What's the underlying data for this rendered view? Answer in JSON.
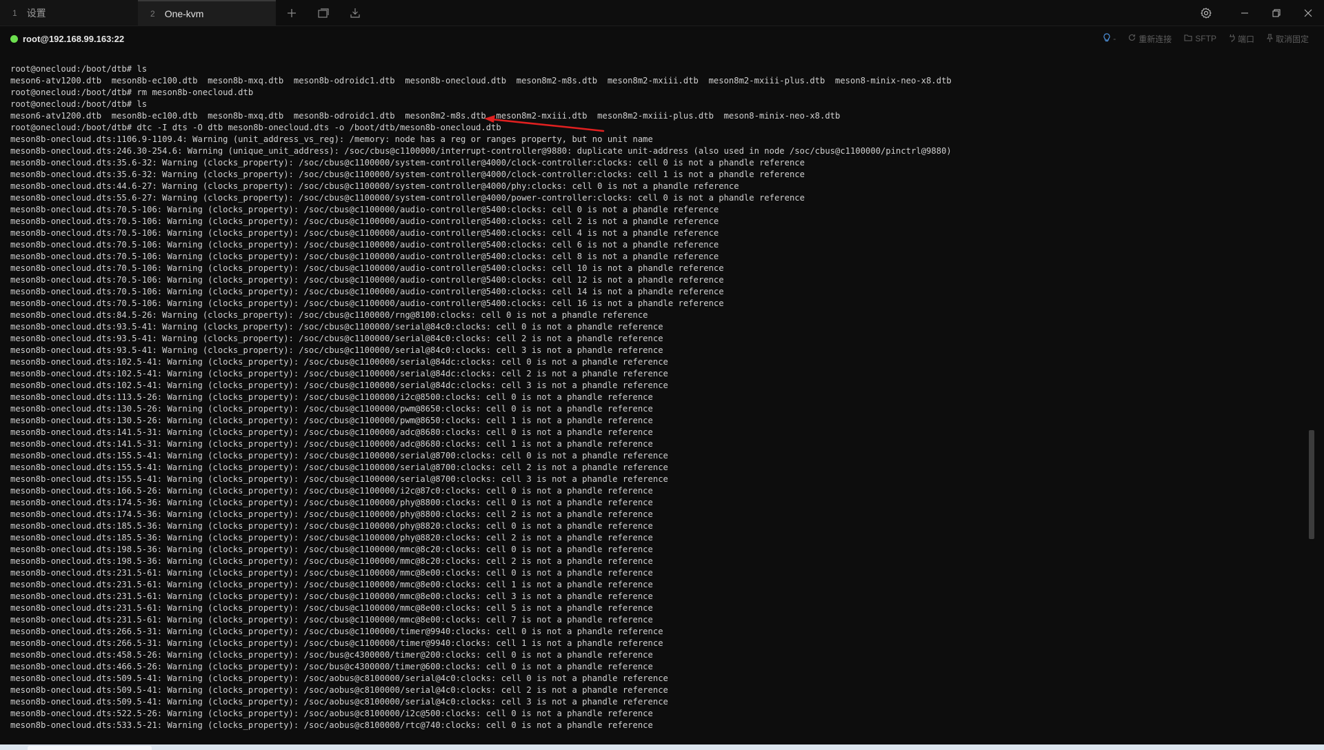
{
  "tabs": [
    {
      "num": "1",
      "label": "设置"
    },
    {
      "num": "2",
      "label": "One-kvm"
    }
  ],
  "icons": {
    "new_tab": "plus-icon",
    "split": "window-split-icon",
    "download": "download-icon",
    "settings": "gear-icon",
    "minimize": "minimize-icon",
    "restore": "restore-icon",
    "close": "close-icon"
  },
  "connection": {
    "host": "root@192.168.99.163:22",
    "status_color": "#6ddf4f",
    "bulb_label": "-",
    "reconnect_label": "重新连接",
    "sftp_label": "SFTP",
    "port_label": "端口",
    "unpin_label": "取消固定"
  },
  "terminal": {
    "lines": [
      "root@onecloud:/boot/dtb# ls",
      "meson6-atv1200.dtb  meson8b-ec100.dtb  meson8b-mxq.dtb  meson8b-odroidc1.dtb  meson8b-onecloud.dtb  meson8m2-m8s.dtb  meson8m2-mxiii.dtb  meson8m2-mxiii-plus.dtb  meson8-minix-neo-x8.dtb",
      "root@onecloud:/boot/dtb# rm meson8b-onecloud.dtb",
      "root@onecloud:/boot/dtb# ls",
      "meson6-atv1200.dtb  meson8b-ec100.dtb  meson8b-mxq.dtb  meson8b-odroidc1.dtb  meson8m2-m8s.dtb  meson8m2-mxiii.dtb  meson8m2-mxiii-plus.dtb  meson8-minix-neo-x8.dtb",
      "root@onecloud:/boot/dtb# dtc -I dts -O dtb meson8b-onecloud.dts -o /boot/dtb/meson8b-onecloud.dtb",
      "meson8b-onecloud.dts:1106.9-1109.4: Warning (unit_address_vs_reg): /memory: node has a reg or ranges property, but no unit name",
      "meson8b-onecloud.dts:246.30-254.6: Warning (unique_unit_address): /soc/cbus@c1100000/interrupt-controller@9880: duplicate unit-address (also used in node /soc/cbus@c1100000/pinctrl@9880)",
      "meson8b-onecloud.dts:35.6-32: Warning (clocks_property): /soc/cbus@c1100000/system-controller@4000/clock-controller:clocks: cell 0 is not a phandle reference",
      "meson8b-onecloud.dts:35.6-32: Warning (clocks_property): /soc/cbus@c1100000/system-controller@4000/clock-controller:clocks: cell 1 is not a phandle reference",
      "meson8b-onecloud.dts:44.6-27: Warning (clocks_property): /soc/cbus@c1100000/system-controller@4000/phy:clocks: cell 0 is not a phandle reference",
      "meson8b-onecloud.dts:55.6-27: Warning (clocks_property): /soc/cbus@c1100000/system-controller@4000/power-controller:clocks: cell 0 is not a phandle reference",
      "meson8b-onecloud.dts:70.5-106: Warning (clocks_property): /soc/cbus@c1100000/audio-controller@5400:clocks: cell 0 is not a phandle reference",
      "meson8b-onecloud.dts:70.5-106: Warning (clocks_property): /soc/cbus@c1100000/audio-controller@5400:clocks: cell 2 is not a phandle reference",
      "meson8b-onecloud.dts:70.5-106: Warning (clocks_property): /soc/cbus@c1100000/audio-controller@5400:clocks: cell 4 is not a phandle reference",
      "meson8b-onecloud.dts:70.5-106: Warning (clocks_property): /soc/cbus@c1100000/audio-controller@5400:clocks: cell 6 is not a phandle reference",
      "meson8b-onecloud.dts:70.5-106: Warning (clocks_property): /soc/cbus@c1100000/audio-controller@5400:clocks: cell 8 is not a phandle reference",
      "meson8b-onecloud.dts:70.5-106: Warning (clocks_property): /soc/cbus@c1100000/audio-controller@5400:clocks: cell 10 is not a phandle reference",
      "meson8b-onecloud.dts:70.5-106: Warning (clocks_property): /soc/cbus@c1100000/audio-controller@5400:clocks: cell 12 is not a phandle reference",
      "meson8b-onecloud.dts:70.5-106: Warning (clocks_property): /soc/cbus@c1100000/audio-controller@5400:clocks: cell 14 is not a phandle reference",
      "meson8b-onecloud.dts:70.5-106: Warning (clocks_property): /soc/cbus@c1100000/audio-controller@5400:clocks: cell 16 is not a phandle reference",
      "meson8b-onecloud.dts:84.5-26: Warning (clocks_property): /soc/cbus@c1100000/rng@8100:clocks: cell 0 is not a phandle reference",
      "meson8b-onecloud.dts:93.5-41: Warning (clocks_property): /soc/cbus@c1100000/serial@84c0:clocks: cell 0 is not a phandle reference",
      "meson8b-onecloud.dts:93.5-41: Warning (clocks_property): /soc/cbus@c1100000/serial@84c0:clocks: cell 2 is not a phandle reference",
      "meson8b-onecloud.dts:93.5-41: Warning (clocks_property): /soc/cbus@c1100000/serial@84c0:clocks: cell 3 is not a phandle reference",
      "meson8b-onecloud.dts:102.5-41: Warning (clocks_property): /soc/cbus@c1100000/serial@84dc:clocks: cell 0 is not a phandle reference",
      "meson8b-onecloud.dts:102.5-41: Warning (clocks_property): /soc/cbus@c1100000/serial@84dc:clocks: cell 2 is not a phandle reference",
      "meson8b-onecloud.dts:102.5-41: Warning (clocks_property): /soc/cbus@c1100000/serial@84dc:clocks: cell 3 is not a phandle reference",
      "meson8b-onecloud.dts:113.5-26: Warning (clocks_property): /soc/cbus@c1100000/i2c@8500:clocks: cell 0 is not a phandle reference",
      "meson8b-onecloud.dts:130.5-26: Warning (clocks_property): /soc/cbus@c1100000/pwm@8650:clocks: cell 0 is not a phandle reference",
      "meson8b-onecloud.dts:130.5-26: Warning (clocks_property): /soc/cbus@c1100000/pwm@8650:clocks: cell 1 is not a phandle reference",
      "meson8b-onecloud.dts:141.5-31: Warning (clocks_property): /soc/cbus@c1100000/adc@8680:clocks: cell 0 is not a phandle reference",
      "meson8b-onecloud.dts:141.5-31: Warning (clocks_property): /soc/cbus@c1100000/adc@8680:clocks: cell 1 is not a phandle reference",
      "meson8b-onecloud.dts:155.5-41: Warning (clocks_property): /soc/cbus@c1100000/serial@8700:clocks: cell 0 is not a phandle reference",
      "meson8b-onecloud.dts:155.5-41: Warning (clocks_property): /soc/cbus@c1100000/serial@8700:clocks: cell 2 is not a phandle reference",
      "meson8b-onecloud.dts:155.5-41: Warning (clocks_property): /soc/cbus@c1100000/serial@8700:clocks: cell 3 is not a phandle reference",
      "meson8b-onecloud.dts:166.5-26: Warning (clocks_property): /soc/cbus@c1100000/i2c@87c0:clocks: cell 0 is not a phandle reference",
      "meson8b-onecloud.dts:174.5-36: Warning (clocks_property): /soc/cbus@c1100000/phy@8800:clocks: cell 0 is not a phandle reference",
      "meson8b-onecloud.dts:174.5-36: Warning (clocks_property): /soc/cbus@c1100000/phy@8800:clocks: cell 2 is not a phandle reference",
      "meson8b-onecloud.dts:185.5-36: Warning (clocks_property): /soc/cbus@c1100000/phy@8820:clocks: cell 0 is not a phandle reference",
      "meson8b-onecloud.dts:185.5-36: Warning (clocks_property): /soc/cbus@c1100000/phy@8820:clocks: cell 2 is not a phandle reference",
      "meson8b-onecloud.dts:198.5-36: Warning (clocks_property): /soc/cbus@c1100000/mmc@8c20:clocks: cell 0 is not a phandle reference",
      "meson8b-onecloud.dts:198.5-36: Warning (clocks_property): /soc/cbus@c1100000/mmc@8c20:clocks: cell 2 is not a phandle reference",
      "meson8b-onecloud.dts:231.5-61: Warning (clocks_property): /soc/cbus@c1100000/mmc@8e00:clocks: cell 0 is not a phandle reference",
      "meson8b-onecloud.dts:231.5-61: Warning (clocks_property): /soc/cbus@c1100000/mmc@8e00:clocks: cell 1 is not a phandle reference",
      "meson8b-onecloud.dts:231.5-61: Warning (clocks_property): /soc/cbus@c1100000/mmc@8e00:clocks: cell 3 is not a phandle reference",
      "meson8b-onecloud.dts:231.5-61: Warning (clocks_property): /soc/cbus@c1100000/mmc@8e00:clocks: cell 5 is not a phandle reference",
      "meson8b-onecloud.dts:231.5-61: Warning (clocks_property): /soc/cbus@c1100000/mmc@8e00:clocks: cell 7 is not a phandle reference",
      "meson8b-onecloud.dts:266.5-31: Warning (clocks_property): /soc/cbus@c1100000/timer@9940:clocks: cell 0 is not a phandle reference",
      "meson8b-onecloud.dts:266.5-31: Warning (clocks_property): /soc/cbus@c1100000/timer@9940:clocks: cell 1 is not a phandle reference",
      "meson8b-onecloud.dts:458.5-26: Warning (clocks_property): /soc/bus@c4300000/timer@200:clocks: cell 0 is not a phandle reference",
      "meson8b-onecloud.dts:466.5-26: Warning (clocks_property): /soc/bus@c4300000/timer@600:clocks: cell 0 is not a phandle reference",
      "meson8b-onecloud.dts:509.5-41: Warning (clocks_property): /soc/aobus@c8100000/serial@4c0:clocks: cell 0 is not a phandle reference",
      "meson8b-onecloud.dts:509.5-41: Warning (clocks_property): /soc/aobus@c8100000/serial@4c0:clocks: cell 2 is not a phandle reference",
      "meson8b-onecloud.dts:509.5-41: Warning (clocks_property): /soc/aobus@c8100000/serial@4c0:clocks: cell 3 is not a phandle reference",
      "meson8b-onecloud.dts:522.5-26: Warning (clocks_property): /soc/aobus@c8100000/i2c@500:clocks: cell 0 is not a phandle reference",
      "meson8b-onecloud.dts:533.5-21: Warning (clocks_property): /soc/aobus@c8100000/rtc@740:clocks: cell 0 is not a phandle reference"
    ],
    "annotation_color": "#e02020"
  }
}
